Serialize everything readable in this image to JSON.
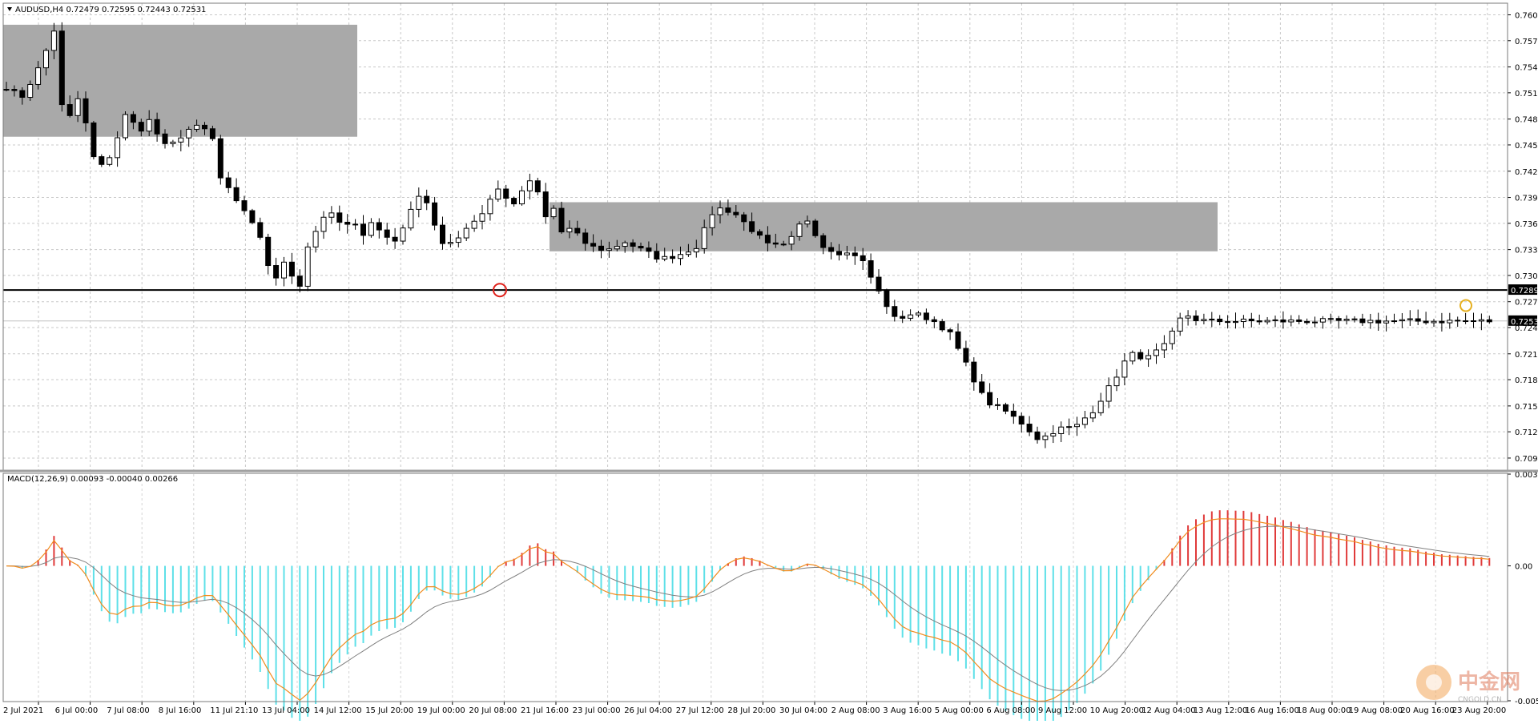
{
  "chart_data": [
    {
      "type": "candlestick",
      "title": "AUDUSD,H4  0.72479 0.72595 0.72443 0.72531",
      "y_ticks": [
        "0.76085",
        "0.75785",
        "0.75480",
        "0.75180",
        "0.74875",
        "0.74575",
        "0.74270",
        "0.73965",
        "0.73665",
        "0.73360",
        "0.73060",
        "0.72755",
        "0.72455",
        "0.72150",
        "0.71850",
        "0.71545",
        "0.71245",
        "0.70940"
      ],
      "ylim": [
        0.708,
        0.7622
      ],
      "support_level": 0.72891,
      "support_label": "0.72891",
      "current_price": 0.72531,
      "current_label": "0.72531",
      "x_ticks": [
        "2 Jul 2021",
        "6 Jul 00:00",
        "7 Jul 08:00",
        "8 Jul 16:00",
        "11 Jul 21:10",
        "13 Jul 04:00",
        "14 Jul 12:00",
        "15 Jul 20:00",
        "19 Jul 00:00",
        "20 Jul 08:00",
        "21 Jul 16:00",
        "23 Jul 00:00",
        "26 Jul 04:00",
        "27 Jul 12:00",
        "28 Jul 20:00",
        "30 Jul 04:00",
        "2 Aug 08:00",
        "3 Aug 16:00",
        "5 Aug 00:00",
        "6 Aug 08:00",
        "9 Aug 12:00",
        "10 Aug 20:00",
        "12 Aug 04:00",
        "13 Aug 12:00",
        "16 Aug 16:00",
        "18 Aug 00:00",
        "19 Aug 08:00",
        "20 Aug 16:00",
        "23 Aug 20:00"
      ],
      "zones": [
        {
          "from": 0,
          "to": 44,
          "low": 0.7467,
          "high": 0.7597
        },
        {
          "from": 68,
          "to": 152,
          "low": 0.7334,
          "high": 0.7391
        }
      ],
      "markers": [
        {
          "bar": 62,
          "price": 0.7289,
          "color": "#e0201a"
        },
        {
          "bar": 183,
          "price": 0.7271,
          "color": "#e6b020"
        }
      ],
      "up_color": "#ffffff",
      "down_color": "#000000"
    },
    {
      "type": "bar+line",
      "title": "MACD(12,26,9) 0.00093 -0.00040 0.00266",
      "y_ticks": [
        "0.0037",
        "0.00",
        "-0.00544"
      ],
      "ylim": [
        -0.00544,
        0.0037
      ],
      "histogram_pos_color": "#e03a3a",
      "histogram_neg_color": "#5ee0e8",
      "macd_color": "#f08c1e",
      "signal_color": "#808080"
    }
  ],
  "watermark": {
    "brand": "中金网",
    "site": "CNGOLD.CN"
  }
}
